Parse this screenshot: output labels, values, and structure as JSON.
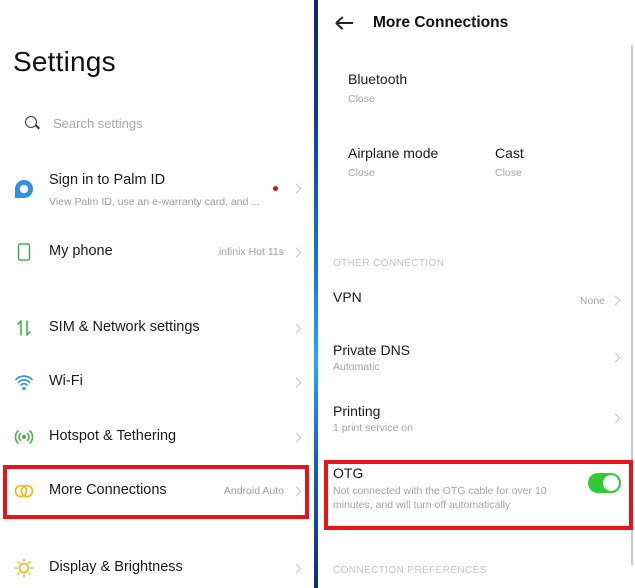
{
  "left_panel": {
    "title": "Settings",
    "search": {
      "placeholder": "Search settings",
      "icon": "search-icon"
    },
    "items": [
      {
        "id": "palm-id",
        "label": "Sign in to Palm ID",
        "sub": "View Palm ID, use an e-warranty card, and ...",
        "icon": "account-bubble-icon",
        "icon_color": "#2f8fe8",
        "badge": "red-dot"
      },
      {
        "id": "my-phone",
        "label": "My phone",
        "value": "infinix Hot 11s",
        "icon": "phone-icon",
        "icon_color": "#4caf50"
      },
      {
        "id": "sim-network",
        "label": "SIM & Network settings",
        "icon": "data-transfer-icon",
        "icon_color": "#4caf50"
      },
      {
        "id": "wifi",
        "label": "Wi-Fi",
        "icon": "wifi-icon",
        "icon_color": "#2f93d6"
      },
      {
        "id": "hotspot",
        "label": "Hotspot & Tethering",
        "icon": "hotspot-icon",
        "icon_color": "#4caf50"
      },
      {
        "id": "more-connections",
        "label": "More Connections",
        "value": "Android Auto",
        "icon": "linked-rings-icon",
        "icon_color": "#e6b800",
        "highlighted": true
      },
      {
        "id": "display",
        "label": "Display & Brightness",
        "icon": "sun-icon",
        "icon_color": "#e6b800"
      }
    ]
  },
  "right_panel": {
    "header": {
      "title": "More Connections",
      "back_icon": "back-arrow-icon"
    },
    "tiles": [
      {
        "label": "Bluetooth",
        "status": "Close"
      },
      {
        "label": "Airplane mode",
        "status": "Close"
      },
      {
        "label": "Cast",
        "status": "Close"
      }
    ],
    "section_other": "OTHER CONNECTION",
    "items": [
      {
        "id": "vpn",
        "label": "VPN",
        "value": "None"
      },
      {
        "id": "private-dns",
        "label": "Private DNS",
        "sub": "Automatic"
      },
      {
        "id": "printing",
        "label": "Printing",
        "sub": "1 print service on"
      }
    ],
    "otg": {
      "label": "OTG",
      "description": "Not connected with the OTG cable for over 10 minutes, and will turn off automatically",
      "enabled": true,
      "highlighted": true
    },
    "section_preferences": "CONNECTION PREFERENCES"
  },
  "colors": {
    "highlight": "#e8141a",
    "toggle_on": "#31c935"
  }
}
